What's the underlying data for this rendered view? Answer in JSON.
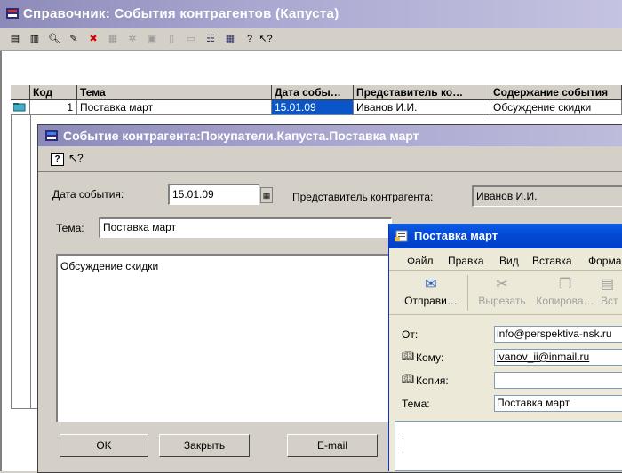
{
  "main_window": {
    "title": "Справочник: События контрагентов (Капуста)",
    "toolbar_icons": [
      "new-icon",
      "copy-icon",
      "find-icon",
      "edit-icon",
      "delete-icon",
      "filter-icon",
      "group-icon",
      "properties-icon",
      "doc-icon",
      "tree-icon",
      "hierarchy-icon",
      "help-icon",
      "whatsthis-icon"
    ]
  },
  "table": {
    "columns": [
      "Код",
      "Тема",
      "Дата собы…",
      "Представитель ко…",
      "Содержание события"
    ],
    "rows": [
      {
        "code": "1",
        "topic": "Поставка март",
        "date": "15.01.09",
        "rep": "Иванов И.И.",
        "content": "Обсуждение скидки"
      }
    ]
  },
  "dialog": {
    "title": "Событие контрагента:Покупатели.Капуста.Поставка март",
    "date_label": "Дата события:",
    "date_value": "15.01.09",
    "rep_label": "Представитель контрагента:",
    "rep_value": "Иванов И.И.",
    "topic_label": "Тема:",
    "topic_value": "Поставка март",
    "content_value": "Обсуждение скидки",
    "ok_label": "OK",
    "close_label": "Закрыть",
    "email_label": "E-mail"
  },
  "mail": {
    "title": "Поставка март",
    "menu": [
      "Файл",
      "Правка",
      "Вид",
      "Вставка",
      "Форма"
    ],
    "toolbar": {
      "send": "Отправи…",
      "cut": "Вырезать",
      "copy": "Копирова…",
      "paste": "Вст"
    },
    "from_label": "От:",
    "from_value": "info@perspektiva-nsk.ru",
    "to_label": "Кому:",
    "to_value": "ivanov_ii@inmail.ru",
    "cc_label": "Копия:",
    "cc_value": "",
    "subject_label": "Тема:",
    "subject_value": "Поставка март"
  }
}
